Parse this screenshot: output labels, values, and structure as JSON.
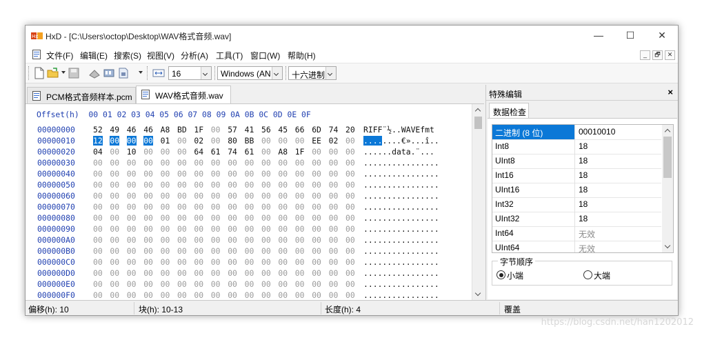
{
  "window": {
    "title": "HxD - [C:\\Users\\octop\\Desktop\\WAV格式音频.wav]",
    "minimize": "—",
    "maximize": "☐",
    "close": "✕"
  },
  "menu": {
    "items": [
      "文件(F)",
      "编辑(E)",
      "搜索(S)",
      "视图(V)",
      "分析(A)",
      "工具(T)",
      "窗口(W)",
      "帮助(H)"
    ],
    "mdi_min": "_",
    "mdi_restore": "🗗",
    "mdi_close": "✕"
  },
  "toolbar": {
    "bytes_per_row": "16",
    "charset": "Windows (AN",
    "display_mode": "十六进制"
  },
  "tabs": [
    {
      "label": "PCM格式音频样本.pcm",
      "active": false
    },
    {
      "label": "WAV格式音频.wav",
      "active": true
    }
  ],
  "hex": {
    "header": "Offset(h)  00 01 02 03 04 05 06 07 08 09 0A 0B 0C 0D 0E 0F",
    "rows": [
      {
        "addr": "00000000",
        "bytes": [
          "52",
          "49",
          "46",
          "46",
          "A8",
          "BD",
          "1F",
          "00",
          "57",
          "41",
          "56",
          "45",
          "66",
          "6D",
          "74",
          "20"
        ],
        "ascii": "RIFF¨½..WAVEfmt "
      },
      {
        "addr": "00000010",
        "bytes": [
          "12",
          "00",
          "00",
          "00",
          "01",
          "00",
          "02",
          "00",
          "80",
          "BB",
          "00",
          "00",
          "00",
          "EE",
          "02",
          "00"
        ],
        "ascii": "........€»...î.."
      },
      {
        "addr": "00000020",
        "bytes": [
          "04",
          "00",
          "10",
          "00",
          "00",
          "00",
          "64",
          "61",
          "74",
          "61",
          "00",
          "A8",
          "1F",
          "00",
          "00",
          "00"
        ],
        "ascii": "......data.¨..."
      },
      {
        "addr": "00000030",
        "bytes": [
          "00",
          "00",
          "00",
          "00",
          "00",
          "00",
          "00",
          "00",
          "00",
          "00",
          "00",
          "00",
          "00",
          "00",
          "00",
          "00"
        ],
        "ascii": "................"
      },
      {
        "addr": "00000040",
        "bytes": [
          "00",
          "00",
          "00",
          "00",
          "00",
          "00",
          "00",
          "00",
          "00",
          "00",
          "00",
          "00",
          "00",
          "00",
          "00",
          "00"
        ],
        "ascii": "................"
      },
      {
        "addr": "00000050",
        "bytes": [
          "00",
          "00",
          "00",
          "00",
          "00",
          "00",
          "00",
          "00",
          "00",
          "00",
          "00",
          "00",
          "00",
          "00",
          "00",
          "00"
        ],
        "ascii": "................"
      },
      {
        "addr": "00000060",
        "bytes": [
          "00",
          "00",
          "00",
          "00",
          "00",
          "00",
          "00",
          "00",
          "00",
          "00",
          "00",
          "00",
          "00",
          "00",
          "00",
          "00"
        ],
        "ascii": "................"
      },
      {
        "addr": "00000070",
        "bytes": [
          "00",
          "00",
          "00",
          "00",
          "00",
          "00",
          "00",
          "00",
          "00",
          "00",
          "00",
          "00",
          "00",
          "00",
          "00",
          "00"
        ],
        "ascii": "................"
      },
      {
        "addr": "00000080",
        "bytes": [
          "00",
          "00",
          "00",
          "00",
          "00",
          "00",
          "00",
          "00",
          "00",
          "00",
          "00",
          "00",
          "00",
          "00",
          "00",
          "00"
        ],
        "ascii": "................"
      },
      {
        "addr": "00000090",
        "bytes": [
          "00",
          "00",
          "00",
          "00",
          "00",
          "00",
          "00",
          "00",
          "00",
          "00",
          "00",
          "00",
          "00",
          "00",
          "00",
          "00"
        ],
        "ascii": "................"
      },
      {
        "addr": "000000A0",
        "bytes": [
          "00",
          "00",
          "00",
          "00",
          "00",
          "00",
          "00",
          "00",
          "00",
          "00",
          "00",
          "00",
          "00",
          "00",
          "00",
          "00"
        ],
        "ascii": "................"
      },
      {
        "addr": "000000B0",
        "bytes": [
          "00",
          "00",
          "00",
          "00",
          "00",
          "00",
          "00",
          "00",
          "00",
          "00",
          "00",
          "00",
          "00",
          "00",
          "00",
          "00"
        ],
        "ascii": "................"
      },
      {
        "addr": "000000C0",
        "bytes": [
          "00",
          "00",
          "00",
          "00",
          "00",
          "00",
          "00",
          "00",
          "00",
          "00",
          "00",
          "00",
          "00",
          "00",
          "00",
          "00"
        ],
        "ascii": "................"
      },
      {
        "addr": "000000D0",
        "bytes": [
          "00",
          "00",
          "00",
          "00",
          "00",
          "00",
          "00",
          "00",
          "00",
          "00",
          "00",
          "00",
          "00",
          "00",
          "00",
          "00"
        ],
        "ascii": "................"
      },
      {
        "addr": "000000E0",
        "bytes": [
          "00",
          "00",
          "00",
          "00",
          "00",
          "00",
          "00",
          "00",
          "00",
          "00",
          "00",
          "00",
          "00",
          "00",
          "00",
          "00"
        ],
        "ascii": "................"
      },
      {
        "addr": "000000F0",
        "bytes": [
          "00",
          "00",
          "00",
          "00",
          "00",
          "00",
          "00",
          "00",
          "00",
          "00",
          "00",
          "00",
          "00",
          "00",
          "00",
          "00"
        ],
        "ascii": "................"
      }
    ],
    "selection": {
      "row": 1,
      "start": 0,
      "end": 3
    }
  },
  "panel": {
    "title": "特殊编辑",
    "close": "×",
    "tab": "数据检查",
    "rows": [
      {
        "name": "二进制 (8 位)",
        "value": "00010010",
        "selected": true,
        "muted": false
      },
      {
        "name": "Int8",
        "value": "18",
        "selected": false,
        "muted": false
      },
      {
        "name": "UInt8",
        "value": "18",
        "selected": false,
        "muted": false
      },
      {
        "name": "Int16",
        "value": "18",
        "selected": false,
        "muted": false
      },
      {
        "name": "UInt16",
        "value": "18",
        "selected": false,
        "muted": false
      },
      {
        "name": "Int32",
        "value": "18",
        "selected": false,
        "muted": false
      },
      {
        "name": "UInt32",
        "value": "18",
        "selected": false,
        "muted": false
      },
      {
        "name": "Int64",
        "value": "无效",
        "selected": false,
        "muted": true
      },
      {
        "name": "UInt64",
        "value": "无效",
        "selected": false,
        "muted": true
      }
    ],
    "byte_order": {
      "legend": "字节顺序",
      "little": "小端",
      "big": "大端",
      "selected": "little"
    }
  },
  "status": {
    "offset": "偏移(h): 10",
    "block": "块(h): 10-13",
    "length": "长度(h): 4",
    "mode": "覆盖"
  },
  "watermark": "https://blog.csdn.net/han1202012",
  "colors": {
    "selection": "#0b78d7",
    "offset_text": "#1f3fb0",
    "zero_byte": "#9a9a9a"
  }
}
